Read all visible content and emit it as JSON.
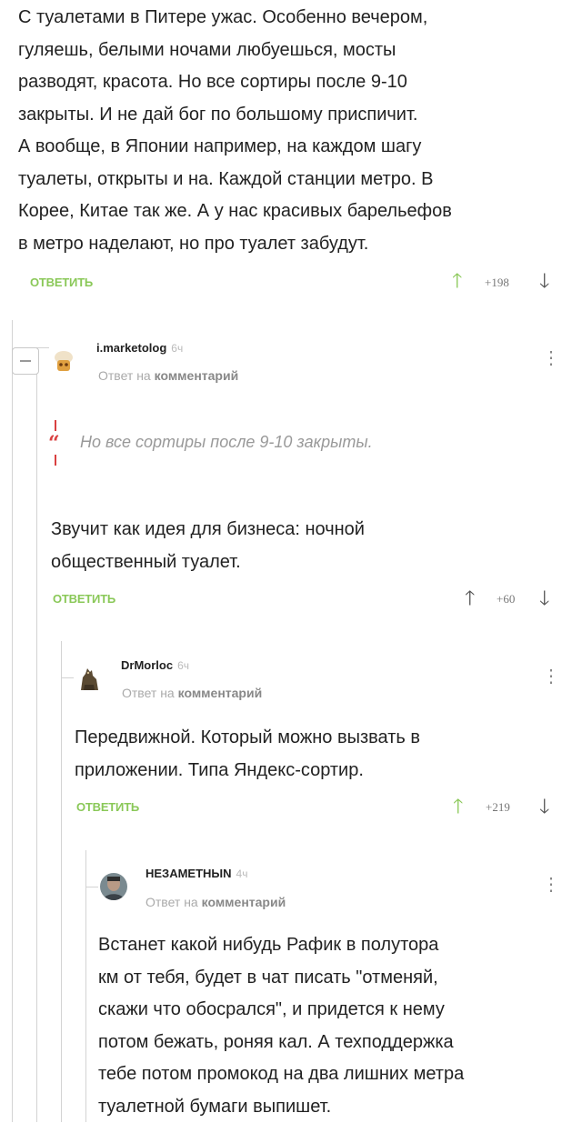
{
  "comments": [
    {
      "text_lines": [
        "С туалетами в Питере ужас. Особенно вечером,",
        "гуляешь, белыми ночами любуешься, мосты",
        "разводят, красота. Но все сортиры после 9-10",
        "закрыты. И не дай бог по большому приспичит.",
        "А вообще, в Японии например, на каждом шагу",
        "туалеты, открыты и на. Каждой станции метро. В",
        "Корее, Китае так же. А у нас красивых барельефов",
        "в метро наделают, но про туалет забудут."
      ],
      "reply_label": "ОТВЕТИТЬ",
      "score": "+198"
    },
    {
      "username": "i.marketolog",
      "time": "6ч",
      "meta_prefix": "Ответ на",
      "meta_link": "комментарий",
      "quote": "Но все сортиры после 9-10 закрыты.",
      "text_lines": [
        "Звучит как идея для бизнеса: ночной",
        "общественный туалет."
      ],
      "reply_label": "ОТВЕТИТЬ",
      "score": "+60"
    },
    {
      "username": "DrMorloc",
      "time": "6ч",
      "meta_prefix": "Ответ на",
      "meta_link": "комментарий",
      "text_lines": [
        "Передвижной. Который можно вызвать в",
        "приложении. Типа Яндекс-сортир."
      ],
      "reply_label": "ОТВЕТИТЬ",
      "score": "+219"
    },
    {
      "username": "НЕЗАМЕТНЫN",
      "time": "4ч",
      "meta_prefix": "Ответ на",
      "meta_link": "комментарий",
      "text_lines": [
        "Встанет какой нибудь Рафик в полутора",
        "км от тебя, будет в чат писать \"отменяй,",
        "скажи что обосрался\", и придется к нему",
        "потом бежать, роняя кал. А техподдержка",
        "тебе потом промокод на два лишних метра",
        "туалетной бумаги выпишет."
      ]
    }
  ],
  "colors": {
    "accent_green": "#8ac858",
    "quote_red": "#d94040",
    "thread_line": "#d3d3d3"
  },
  "icons": [
    "upvote-arrow-icon",
    "downvote-arrow-icon",
    "more-dots-icon",
    "collapse-minus-icon",
    "quote-icon"
  ]
}
